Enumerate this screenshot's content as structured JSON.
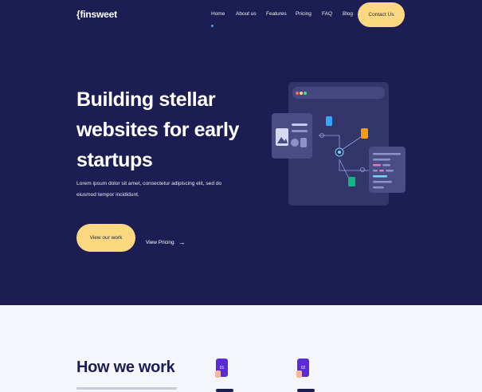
{
  "logo": {
    "text": "{finsweet"
  },
  "nav": {
    "items": [
      {
        "label": "Home"
      },
      {
        "label": "About us"
      },
      {
        "label": "Features"
      },
      {
        "label": "Pricing"
      },
      {
        "label": "FAQ"
      },
      {
        "label": "Blog"
      }
    ],
    "contact_label": "Contact Us"
  },
  "hero": {
    "headline": "Building stellar websites for early startups",
    "description": "Lorem ipsum dolor sit amet, consectetur adipiscing elit, sed do eiusmod tempor incididunt.",
    "primary_button": "View our work",
    "secondary_link": "View Pricing",
    "secondary_icon": "arrow-right-icon"
  },
  "how_we_work": {
    "title": "How we work",
    "steps": [
      {
        "number": "01"
      },
      {
        "number": "02"
      }
    ]
  },
  "colors": {
    "hero_bg": "#1c1e53",
    "accent": "#fcd980",
    "page_bg": "#f4f6fb",
    "step_icon": "#5a2bd7"
  }
}
